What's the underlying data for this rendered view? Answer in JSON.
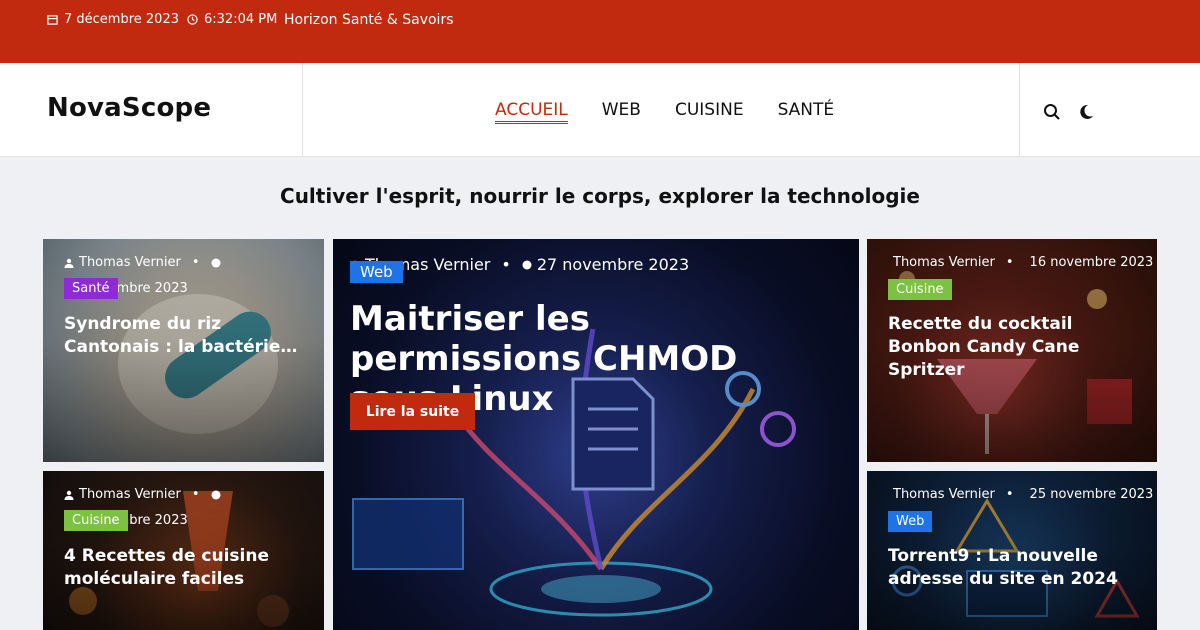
{
  "topbar": {
    "date": "7 décembre 2023",
    "time": "6:32:04 PM",
    "site_tagline": "Horizon Santé & Savoirs"
  },
  "header": {
    "logo": "NovaScope",
    "nav": [
      "ACCUEIL",
      "WEB",
      "CUISINE",
      "SANTÉ"
    ],
    "active": "ACCUEIL"
  },
  "tagline": "Cultiver l'esprit, nourrir le corps, explorer la technologie",
  "colors": {
    "accent": "#c22a10",
    "sante": "#8e2bd4",
    "cuisine": "#7cc242",
    "web": "#1e73e8"
  },
  "cards": [
    {
      "author": "Thomas Vernier",
      "date": "29 novembre 2023",
      "category": "Santé",
      "title": "Syndrome du riz Cantonais : la bactérie…"
    },
    {
      "author": "Thomas Vernier",
      "date": "27 novembre 2023",
      "category": "Web",
      "title": "Maitriser les permissions CHMOD sous Linux",
      "cta": "Lire la suite"
    },
    {
      "author": "Thomas Vernier",
      "date": "16 novembre 2023",
      "category": "Cuisine",
      "title": "Recette du cocktail Bonbon Candy Cane Spritzer"
    },
    {
      "author": "Thomas Vernier",
      "date": "28 novembre 2023",
      "category": "Cuisine",
      "title": "4 Recettes de cuisine moléculaire faciles"
    },
    {
      "author": "Thomas Vernier",
      "date": "25 novembre 2023",
      "category": "Web",
      "title": "Torrent9 : La nouvelle adresse du site en 2024"
    }
  ]
}
